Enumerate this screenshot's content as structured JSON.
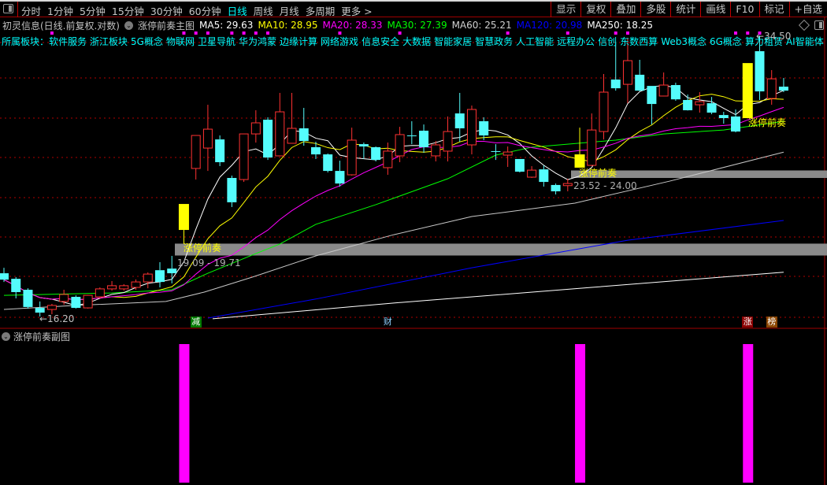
{
  "toolbar": {
    "periods": [
      "分时",
      "1分钟",
      "5分钟",
      "15分钟",
      "30分钟",
      "60分钟",
      "日线",
      "周线",
      "月线",
      "多周期",
      "更多 >"
    ],
    "active_period": "日线",
    "right_buttons": [
      "显示",
      "复权",
      "叠加",
      "多股",
      "统计",
      "画线",
      "F10",
      "标记",
      "+自选"
    ]
  },
  "title": {
    "stock": "初灵信息(日线.前复权.对数)",
    "indicator": "涨停前奏主图",
    "ma": [
      {
        "label": "MA5: 29.63",
        "color": "#ffffff"
      },
      {
        "label": "MA10: 28.95",
        "color": "#ffff00"
      },
      {
        "label": "MA20: 28.33",
        "color": "#ff00ff"
      },
      {
        "label": "MA30: 27.39",
        "color": "#00ff00"
      },
      {
        "label": "MA60: 25.21",
        "color": "#d0d0d0"
      },
      {
        "label": "MA120: 20.98",
        "color": "#0000ff"
      },
      {
        "label": "MA250: 18.25",
        "color": "#ffffff"
      }
    ]
  },
  "sectors": {
    "label": "所属板块：",
    "items": [
      "软件服务",
      "浙江板块",
      "5G概念",
      "物联网",
      "卫星导航",
      "华为鸿蒙",
      "边缘计算",
      "网络游戏",
      "信息安全",
      "大数据",
      "智能家居",
      "智慧政务",
      "人工智能",
      "远程办公",
      "信创",
      "东数西算",
      "Web3概念",
      "6G概念",
      "算力租赁",
      "AI智能体"
    ]
  },
  "colors": {
    "up": "#ff3232",
    "down": "#54fcfc",
    "limit_up": "#ffff00",
    "grid": "#b00000",
    "signal_bar": "#ff00ff"
  },
  "annotations": {
    "high_label": "←34.50",
    "low_label": "←16.20",
    "signal_label": "涨停前奏",
    "band1_range": "19.09 - 19.71",
    "band2_range": "23.52 - 24.00",
    "band1": [
      19.09,
      19.71
    ],
    "band2": [
      23.52,
      24.0
    ],
    "events": [
      {
        "text": "减",
        "candle": 17,
        "bg": "#007a00",
        "color": "#ffffff"
      },
      {
        "text": "财",
        "candle": 33,
        "bg": "transparent",
        "color": "#8fd0ff"
      },
      {
        "text": "涨",
        "candle": 63,
        "bg": "#8b0000",
        "color": "#ffffff"
      },
      {
        "text": "榜",
        "candle": 65,
        "bg": "#8b4500",
        "color": "#ffffff"
      }
    ],
    "top_marks": [
      5,
      16,
      17,
      18,
      20,
      21,
      22,
      23,
      29,
      34,
      43,
      48,
      52,
      53,
      62,
      63,
      64
    ]
  },
  "sub_chart": {
    "title": "涨停前奏副图",
    "signal_candles": [
      16,
      49,
      63
    ]
  },
  "chart_data": {
    "type": "candlestick",
    "scale": "log",
    "ylim": [
      16.2,
      34.5
    ],
    "grid": true,
    "candles": [
      {
        "o": 18.2,
        "h": 18.47,
        "l": 17.78,
        "c": 17.89
      },
      {
        "o": 17.93,
        "h": 18.01,
        "l": 17.01,
        "c": 17.3
      },
      {
        "o": 17.41,
        "h": 17.48,
        "l": 16.55,
        "c": 16.62
      },
      {
        "o": 16.58,
        "h": 16.87,
        "l": 16.2,
        "c": 16.37
      },
      {
        "o": 16.51,
        "h": 16.76,
        "l": 16.3,
        "c": 16.69
      },
      {
        "o": 16.87,
        "h": 17.41,
        "l": 16.72,
        "c": 17.19
      },
      {
        "o": 17.08,
        "h": 17.15,
        "l": 16.55,
        "c": 16.58
      },
      {
        "o": 16.58,
        "h": 17.17,
        "l": 16.55,
        "c": 17.15
      },
      {
        "o": 17.08,
        "h": 17.52,
        "l": 17.01,
        "c": 17.45
      },
      {
        "o": 17.45,
        "h": 17.82,
        "l": 17.37,
        "c": 17.6
      },
      {
        "o": 17.45,
        "h": 17.67,
        "l": 17.37,
        "c": 17.6
      },
      {
        "o": 17.52,
        "h": 17.9,
        "l": 17.41,
        "c": 17.78
      },
      {
        "o": 17.78,
        "h": 18.24,
        "l": 17.48,
        "c": 18.16
      },
      {
        "o": 18.35,
        "h": 18.75,
        "l": 17.52,
        "c": 17.78
      },
      {
        "o": 18.43,
        "h": 19.07,
        "l": 17.71,
        "c": 18.2
      },
      {
        "o": 20.45,
        "h": 21.93,
        "l": 19.69,
        "c": 21.93,
        "limit_up": true
      },
      {
        "o": 24.13,
        "h": 26.37,
        "l": 23.42,
        "c": 26.37
      },
      {
        "o": 25.49,
        "h": 28.64,
        "l": 23.97,
        "c": 26.82
      },
      {
        "o": 26.09,
        "h": 26.37,
        "l": 24.28,
        "c": 24.54
      },
      {
        "o": 23.52,
        "h": 23.67,
        "l": 21.75,
        "c": 22.03
      },
      {
        "o": 23.42,
        "h": 26.48,
        "l": 23.27,
        "c": 26.48
      },
      {
        "o": 26.48,
        "h": 28.22,
        "l": 25.87,
        "c": 27.28
      },
      {
        "o": 27.51,
        "h": 27.69,
        "l": 24.69,
        "c": 24.85
      },
      {
        "o": 24.96,
        "h": 29.57,
        "l": 24.96,
        "c": 28.1
      },
      {
        "o": 25.82,
        "h": 29.57,
        "l": 25.82,
        "c": 26.88
      },
      {
        "o": 26.88,
        "h": 28.4,
        "l": 25.65,
        "c": 25.98
      },
      {
        "o": 25.55,
        "h": 25.93,
        "l": 24.75,
        "c": 25.06
      },
      {
        "o": 25.06,
        "h": 25.12,
        "l": 23.87,
        "c": 23.97
      },
      {
        "o": 23.97,
        "h": 24.64,
        "l": 22.98,
        "c": 23.17
      },
      {
        "o": 23.72,
        "h": 26.93,
        "l": 23.67,
        "c": 26.04
      },
      {
        "o": 25.76,
        "h": 25.87,
        "l": 24.75,
        "c": 25.6
      },
      {
        "o": 25.55,
        "h": 25.6,
        "l": 24.59,
        "c": 24.69
      },
      {
        "o": 24.18,
        "h": 25.87,
        "l": 23.72,
        "c": 25.28
      },
      {
        "o": 24.96,
        "h": 26.99,
        "l": 24.54,
        "c": 26.43
      },
      {
        "o": 26.37,
        "h": 27.4,
        "l": 25.76,
        "c": 26.35
      },
      {
        "o": 26.71,
        "h": 27.16,
        "l": 25.17,
        "c": 25.55
      },
      {
        "o": 24.96,
        "h": 25.98,
        "l": 24.59,
        "c": 25.71
      },
      {
        "o": 25.28,
        "h": 27.75,
        "l": 24.59,
        "c": 26.65
      },
      {
        "o": 27.98,
        "h": 29.57,
        "l": 25.93,
        "c": 26.88
      },
      {
        "o": 25.71,
        "h": 28.58,
        "l": 25.06,
        "c": 28.28
      },
      {
        "o": 27.4,
        "h": 27.69,
        "l": 26.04,
        "c": 26.37
      },
      {
        "o": 25.28,
        "h": 25.76,
        "l": 24.69,
        "c": 25.26
      },
      {
        "o": 25.01,
        "h": 25.6,
        "l": 24.23,
        "c": 25.22
      },
      {
        "o": 24.75,
        "h": 24.75,
        "l": 23.87,
        "c": 23.92
      },
      {
        "o": 23.57,
        "h": 24.28,
        "l": 23.52,
        "c": 24.02
      },
      {
        "o": 24.07,
        "h": 24.33,
        "l": 22.98,
        "c": 23.27
      },
      {
        "o": 23.08,
        "h": 23.17,
        "l": 22.5,
        "c": 22.69
      },
      {
        "o": 23.04,
        "h": 23.47,
        "l": 22.69,
        "c": 23.17
      },
      {
        "o": 24.18,
        "h": 26.93,
        "l": 24.18,
        "c": 25.06,
        "limit_up": true
      },
      {
        "o": 24.33,
        "h": 27.98,
        "l": 24.28,
        "c": 26.76
      },
      {
        "o": 26.65,
        "h": 31.11,
        "l": 26.09,
        "c": 29.63
      },
      {
        "o": 30.65,
        "h": 33.93,
        "l": 29.75,
        "c": 29.94
      },
      {
        "o": 30.26,
        "h": 34.3,
        "l": 28.76,
        "c": 32.25
      },
      {
        "o": 31.05,
        "h": 32.32,
        "l": 29.7,
        "c": 29.75
      },
      {
        "o": 30.13,
        "h": 30.13,
        "l": 27.16,
        "c": 28.7
      },
      {
        "o": 29.32,
        "h": 31.24,
        "l": 29.3,
        "c": 30.2
      },
      {
        "o": 30.2,
        "h": 30.39,
        "l": 28.95,
        "c": 29.06
      },
      {
        "o": 29.01,
        "h": 29.44,
        "l": 28.2,
        "c": 28.22
      },
      {
        "o": 28.64,
        "h": 29.63,
        "l": 28.04,
        "c": 28.88
      },
      {
        "o": 28.76,
        "h": 29.25,
        "l": 27.92,
        "c": 28.04
      },
      {
        "o": 27.86,
        "h": 28.1,
        "l": 27.22,
        "c": 27.63
      },
      {
        "o": 27.75,
        "h": 28.28,
        "l": 26.59,
        "c": 26.65
      },
      {
        "o": 27.63,
        "h": 32.04,
        "l": 27.63,
        "c": 32.04,
        "limit_up": true
      },
      {
        "o": 33.08,
        "h": 34.5,
        "l": 29.01,
        "c": 29.69
      },
      {
        "o": 29.13,
        "h": 31.44,
        "l": 28.64,
        "c": 30.71
      },
      {
        "o": 30.07,
        "h": 30.78,
        "l": 29.63,
        "c": 29.75
      }
    ],
    "computed_ma": [
      {
        "name": "MA5",
        "period": 5,
        "color": "#ffffff"
      },
      {
        "name": "MA10",
        "period": 10,
        "color": "#ffff00"
      },
      {
        "name": "MA20",
        "period": 20,
        "color": "#ff00ff"
      }
    ],
    "long_ma": [
      {
        "name": "MA30",
        "color": "#00ff00",
        "points": [
          [
            1,
            17.15
          ],
          [
            10,
            17.26
          ],
          [
            15,
            17.41
          ],
          [
            18,
            18.2
          ],
          [
            22,
            19.19
          ],
          [
            24,
            19.69
          ],
          [
            27,
            20.76
          ],
          [
            32,
            21.89
          ],
          [
            38,
            23.47
          ],
          [
            42,
            25.01
          ],
          [
            45,
            25.55
          ],
          [
            52,
            26.04
          ],
          [
            56,
            26.48
          ],
          [
            61,
            26.76
          ],
          [
            66,
            27.39
          ]
        ]
      },
      {
        "name": "MA60",
        "color": "#c8c8c8",
        "points": [
          [
            1,
            16.51
          ],
          [
            7,
            16.69
          ],
          [
            14.5,
            16.87
          ],
          [
            17.7,
            17.3
          ],
          [
            21.7,
            18.01
          ],
          [
            27,
            19.07
          ],
          [
            33.5,
            20.19
          ],
          [
            40,
            21.2
          ],
          [
            48.6,
            21.98
          ],
          [
            56.5,
            23.32
          ],
          [
            66,
            25.21
          ]
        ]
      },
      {
        "name": "MA120",
        "color": "#0000ff",
        "points": [
          [
            18,
            16.13
          ],
          [
            27,
            16.98
          ],
          [
            40,
            18.47
          ],
          [
            53,
            19.89
          ],
          [
            66,
            20.98
          ]
        ]
      },
      {
        "name": "MA250",
        "color": "#ffffff",
        "points": [
          [
            18.4,
            16.1
          ],
          [
            33.5,
            16.8
          ],
          [
            50,
            17.52
          ],
          [
            66,
            18.25
          ]
        ]
      }
    ]
  }
}
